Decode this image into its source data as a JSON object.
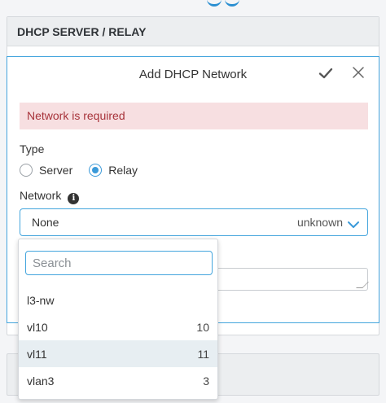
{
  "panel": {
    "title": "DHCP SERVER / RELAY"
  },
  "modal": {
    "title": "Add DHCP Network",
    "alert": "Network is required",
    "type_label": "Type",
    "type_options": [
      {
        "label": "Server",
        "selected": false
      },
      {
        "label": "Relay",
        "selected": true
      }
    ],
    "network_label": "Network",
    "network_select": {
      "value": "None",
      "extra": "unknown"
    }
  },
  "dropdown": {
    "search_placeholder": "Search",
    "options": [
      {
        "label": "l3-nw",
        "count": ""
      },
      {
        "label": "vl10",
        "count": "10"
      },
      {
        "label": "vl11",
        "count": "11",
        "highlighted": true
      },
      {
        "label": "vlan3",
        "count": "3"
      }
    ]
  },
  "colors": {
    "accent": "#44a5dd",
    "alert_bg": "#f7dfe1",
    "alert_text": "#a7333a",
    "highlight": "#e7eef2"
  }
}
